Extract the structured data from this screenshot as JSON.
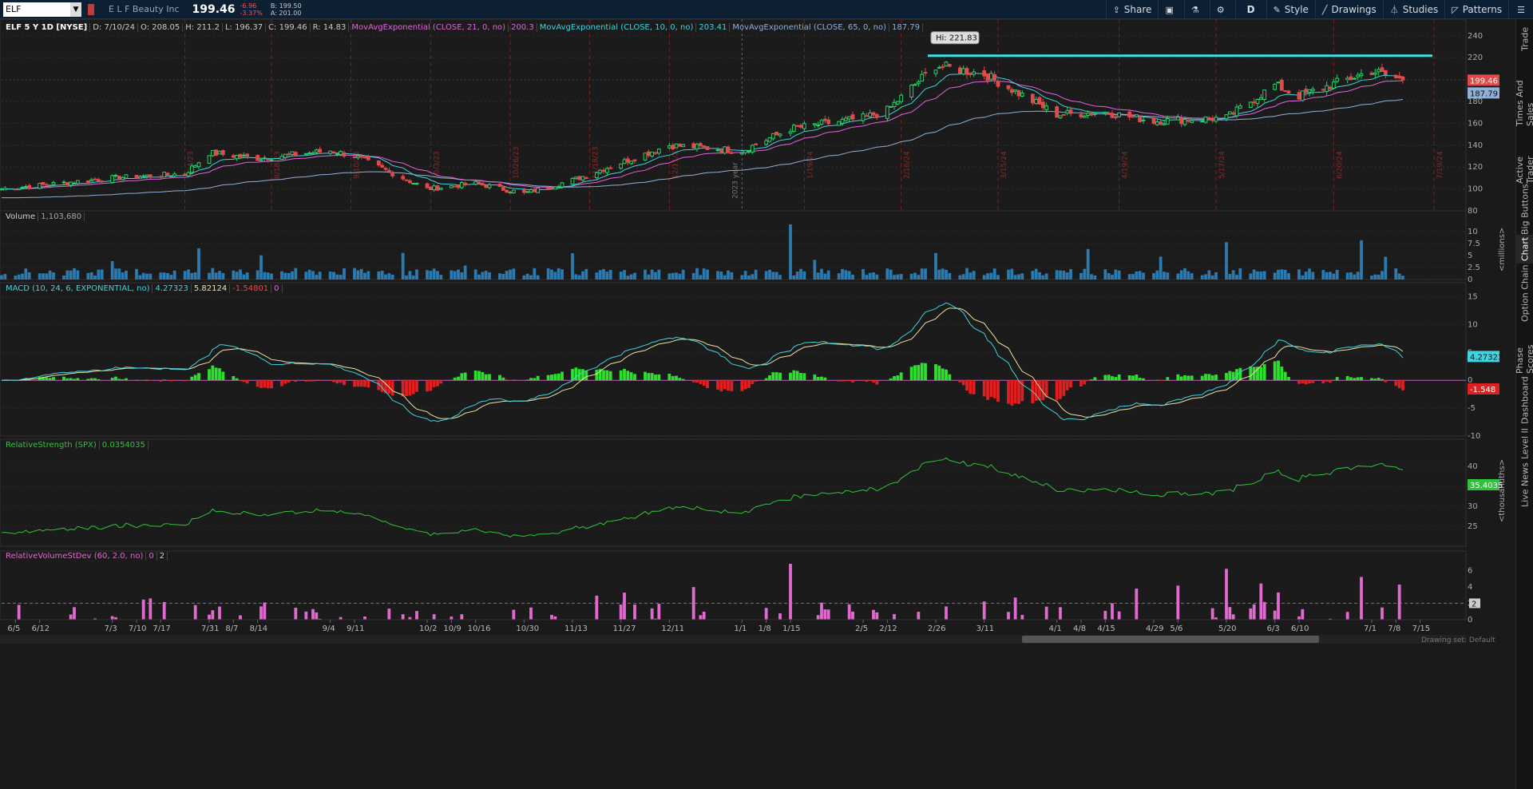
{
  "toolbar": {
    "symbol": "ELF",
    "company": "E L F Beauty Inc",
    "last": "199.46",
    "change": "-6.96",
    "change_pct": "-3.37%",
    "bid": "B: 199.50",
    "ask": "A: 201.00",
    "share": "Share",
    "aggregation": "D",
    "style": "Style",
    "drawings": "Drawings",
    "studies": "Studies",
    "patterns": "Patterns"
  },
  "side_tabs": [
    "Trade",
    "Times And Sales",
    "Active Trader",
    "Big Buttons",
    "Chart",
    "Option Chain",
    "Phase Scores",
    "Dashboard",
    "Level II",
    "Live News"
  ],
  "active_tab": "Chart",
  "price_pane": {
    "header": [
      "ELF 5 Y 1D [NYSE]",
      "D: 7/10/24",
      "O: 208.05",
      "H: 211.2",
      "L: 196.37",
      "C: 199.46",
      "R: 14.83"
    ],
    "studies": [
      {
        "label": "MovAvgExponential (CLOSE, 21, 0, no)",
        "value": "200.3",
        "color": "#e065e0"
      },
      {
        "label": "MovAvgExponential (CLOSE, 10, 0, no)",
        "value": "203.41",
        "color": "#3fd4e0"
      },
      {
        "label": "MovAvgExponential (CLOSE, 65, 0, no)",
        "value": "187.79",
        "color": "#8fb0d8"
      }
    ],
    "hi_label": "Hi: 221.83",
    "price_tag": "199.46",
    "ema65_tag": "187.79",
    "year_label": "2023 year",
    "y_ticks": [
      240,
      220,
      200,
      180,
      160,
      140,
      120,
      100,
      80
    ],
    "date_markers": [
      "7/24/23",
      "8/18/23",
      "9/10/23",
      "10/3/23",
      "10/26/23",
      "11/18/23",
      "12/11/23",
      "1/19/24",
      "2/16/24",
      "3/15/24",
      "4/19/24",
      "5/17/24",
      "6/20/24",
      "7/19/24"
    ]
  },
  "volume_pane": {
    "label": "Volume",
    "value": "1,103,680",
    "unit": "<millions>",
    "y_ticks": [
      "10",
      "7.5",
      "5",
      "2.5",
      "0"
    ]
  },
  "macd_pane": {
    "label": "MACD (10, 24, 6, EXPONENTIAL, no)",
    "value": "4.27323",
    "avg": "5.82124",
    "diff": "-1.54801",
    "zero": "0",
    "tag_value": "4.27323",
    "tag_diff": "-1.548",
    "y_ticks": [
      "15",
      "10",
      "5",
      "0",
      "-5",
      "-10"
    ]
  },
  "rs_pane": {
    "label": "RelativeStrength (SPX)",
    "value": "0.0354035",
    "tag": "35.4035",
    "unit": "<thousandths>",
    "y_ticks": [
      "40",
      "35",
      "30",
      "25"
    ]
  },
  "rvsd_pane": {
    "label": "RelativeVolumeStDev (60, 2.0, no)",
    "v1": "0",
    "v2": "2",
    "tag": "2",
    "y_ticks": [
      "6",
      "4",
      "2",
      "0"
    ]
  },
  "x_axis": [
    "6/5",
    "6/12",
    "7/3",
    "7/10",
    "7/17",
    "7/31",
    "8/7",
    "8/14",
    "9/4",
    "9/11",
    "10/2",
    "10/9",
    "10/16",
    "10/30",
    "11/13",
    "11/27",
    "12/11",
    "1/1",
    "1/8",
    "1/15",
    "2/5",
    "2/12",
    "2/26",
    "3/11",
    "4/1",
    "4/8",
    "4/15",
    "4/29",
    "5/6",
    "5/20",
    "6/3",
    "6/10",
    "7/1",
    "7/8",
    "7/15"
  ],
  "footer": {
    "drawing_set": "Drawing set: Default"
  },
  "chart_data": {
    "type": "candlestick",
    "title": "ELF 5 Y 1D [NYSE]",
    "ylim": [
      80,
      245
    ],
    "anchors": [
      {
        "x": "6/1/23",
        "close": 100
      },
      {
        "x": "7/3/23",
        "close": 110
      },
      {
        "x": "7/24/23",
        "close": 114
      },
      {
        "x": "7/31/23",
        "close": 133
      },
      {
        "x": "8/14/23",
        "close": 128
      },
      {
        "x": "9/4/23",
        "close": 135
      },
      {
        "x": "9/11/23",
        "close": 130
      },
      {
        "x": "10/2/23",
        "close": 100
      },
      {
        "x": "10/16/23",
        "close": 105
      },
      {
        "x": "10/30/23",
        "close": 96
      },
      {
        "x": "11/13/23",
        "close": 108
      },
      {
        "x": "12/11/23",
        "close": 140
      },
      {
        "x": "1/1/24",
        "close": 135
      },
      {
        "x": "1/15/24",
        "close": 155
      },
      {
        "x": "2/5/24",
        "close": 165
      },
      {
        "x": "2/12/24",
        "close": 172
      },
      {
        "x": "2/26/24",
        "close": 213
      },
      {
        "x": "3/11/24",
        "close": 205
      },
      {
        "x": "4/1/24",
        "close": 168
      },
      {
        "x": "4/15/24",
        "close": 170
      },
      {
        "x": "4/29/24",
        "close": 162
      },
      {
        "x": "5/20/24",
        "close": 165
      },
      {
        "x": "6/3/24",
        "close": 195
      },
      {
        "x": "6/10/24",
        "close": 185
      },
      {
        "x": "7/1/24",
        "close": 208
      },
      {
        "x": "7/10/24",
        "close": 199.46
      }
    ],
    "hi_level": 221.83,
    "ema_last": {
      "ema10": 203.41,
      "ema21": 200.3,
      "ema65": 187.79
    }
  }
}
